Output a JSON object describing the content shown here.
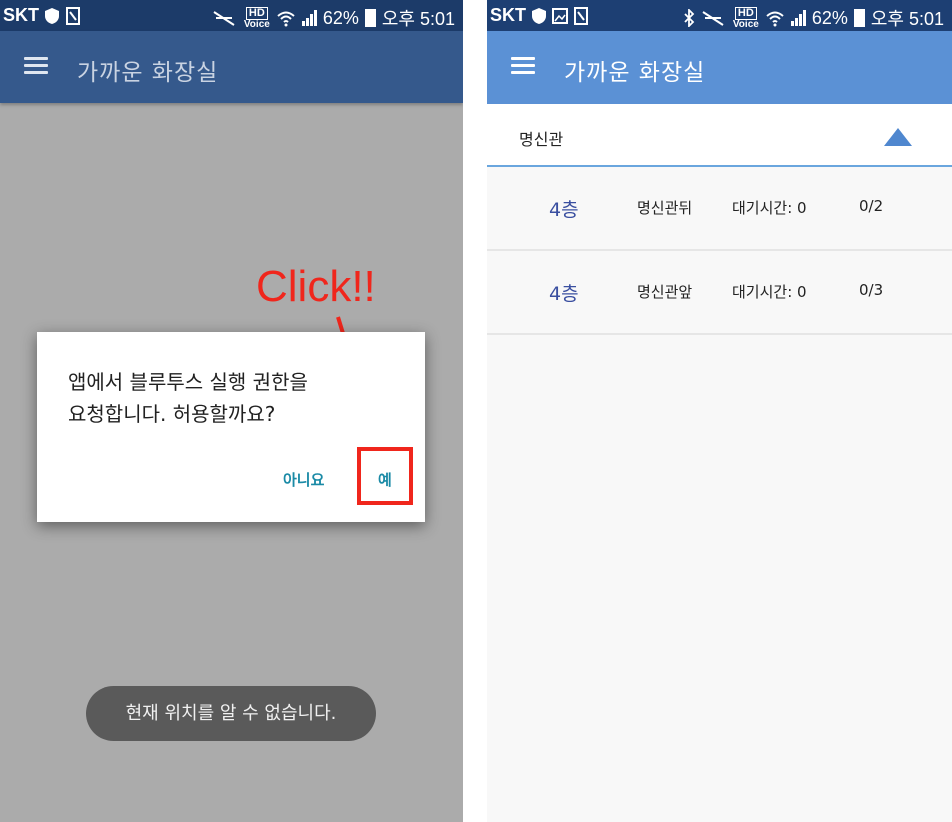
{
  "left_phone": {
    "status": {
      "carrier": "SKT",
      "hd": "HD",
      "voice": "Voice",
      "battery": "62%",
      "time": "오후 5:01"
    },
    "app_title": "가까운 화장실",
    "dialog": {
      "message_line1": "앱에서 블루투스 실행 권한을",
      "message_line2": "요청합니다. 허용할까요?",
      "no_label": "아니요",
      "yes_label": "예"
    },
    "annotation": {
      "text": "Click!!",
      "color": "#f0261c"
    },
    "toast": "현재 위치를 알 수 없습니다."
  },
  "right_phone": {
    "status": {
      "carrier": "SKT",
      "hd": "HD",
      "voice": "Voice",
      "battery": "62%",
      "time": "오후 5:01"
    },
    "app_title": "가까운 화장실",
    "section": {
      "title": "명신관",
      "expanded": true
    },
    "rows": [
      {
        "floor": "4층",
        "place": "명신관뒤",
        "wait": "대기시간: 0",
        "count": "0/2"
      },
      {
        "floor": "4층",
        "place": "명신관앞",
        "wait": "대기시간: 0",
        "count": "0/3"
      }
    ]
  },
  "colors": {
    "accent": "#5b91d5",
    "dialog_button": "#1a8aa6",
    "annotation": "#f0261c"
  }
}
